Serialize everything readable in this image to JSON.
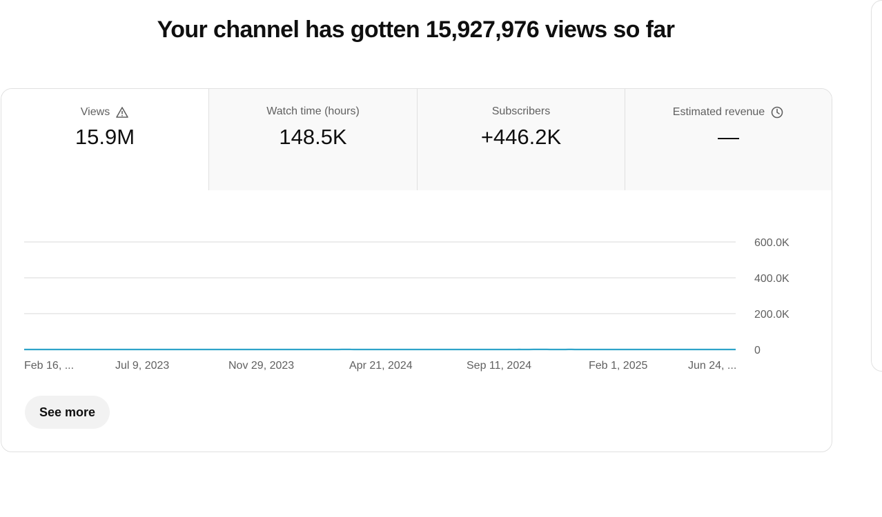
{
  "headline": "Your channel has gotten 15,927,976 views so far",
  "tabs": [
    {
      "label": "Views",
      "value": "15.9M",
      "icon": "warning-icon",
      "active": true
    },
    {
      "label": "Watch time (hours)",
      "value": "148.5K",
      "icon": "",
      "active": false
    },
    {
      "label": "Subscribers",
      "value": "+446.2K",
      "icon": "",
      "active": false
    },
    {
      "label": "Estimated revenue",
      "value": "—",
      "icon": "clock-icon",
      "active": false
    }
  ],
  "see_more_label": "See more",
  "colors": {
    "line": "#2ea3c9",
    "fill": "#dff3fa",
    "grid": "#e5e5e5",
    "baseline": "#666666"
  },
  "chart_data": {
    "type": "area",
    "series": [
      {
        "values": [
          [
            0,
            0
          ],
          [
            210,
            0
          ],
          [
            220,
            2
          ],
          [
            235,
            4
          ],
          [
            250,
            3
          ],
          [
            260,
            2
          ],
          [
            270,
            2
          ],
          [
            280,
            5
          ],
          [
            290,
            8
          ],
          [
            300,
            30
          ],
          [
            305,
            100
          ],
          [
            308,
            300
          ],
          [
            312,
            480
          ],
          [
            316,
            300
          ],
          [
            320,
            120
          ],
          [
            325,
            40
          ],
          [
            330,
            20
          ],
          [
            335,
            30
          ],
          [
            340,
            18
          ],
          [
            350,
            25
          ],
          [
            360,
            15
          ],
          [
            370,
            20
          ],
          [
            380,
            10
          ],
          [
            390,
            5
          ],
          [
            400,
            0
          ],
          [
            440,
            0
          ],
          [
            450,
            3
          ],
          [
            460,
            8
          ],
          [
            470,
            10
          ],
          [
            475,
            40
          ],
          [
            478,
            150
          ],
          [
            480,
            470
          ],
          [
            482,
            0
          ],
          [
            485,
            12
          ],
          [
            490,
            120
          ],
          [
            494,
            410
          ],
          [
            497,
            590
          ],
          [
            500,
            400
          ],
          [
            503,
            330
          ],
          [
            507,
            200
          ],
          [
            510,
            60
          ],
          [
            513,
            10
          ],
          [
            517,
            50
          ],
          [
            520,
            100
          ],
          [
            525,
            180
          ],
          [
            528,
            280
          ],
          [
            531,
            220
          ],
          [
            534,
            30
          ],
          [
            538,
            0
          ],
          [
            560,
            0
          ],
          [
            565,
            2
          ],
          [
            575,
            6
          ],
          [
            585,
            10
          ],
          [
            595,
            5
          ],
          [
            605,
            10
          ],
          [
            615,
            7
          ],
          [
            620,
            15
          ],
          [
            625,
            5
          ],
          [
            635,
            10
          ],
          [
            640,
            30
          ],
          [
            644,
            100
          ],
          [
            647,
            170
          ],
          [
            652,
            110
          ],
          [
            655,
            50
          ],
          [
            660,
            5
          ],
          [
            670,
            0
          ],
          [
            690,
            0
          ]
        ]
      }
    ],
    "x_range": [
      "Feb 16, 2023",
      "Jul 4, 2025"
    ],
    "y_range": [
      0,
      600000
    ],
    "xticks": [
      "Feb 16, ...",
      "Jul 9, 2023",
      "Nov 29, 2023",
      "Apr 21, 2024",
      "Sep 11, 2024",
      "Feb 1, 2025",
      "Jun 24, ..."
    ],
    "yticks": [
      "0",
      "200.0K",
      "400.0K",
      "600.0K"
    ],
    "grid": true,
    "yaxis_side": "right"
  }
}
